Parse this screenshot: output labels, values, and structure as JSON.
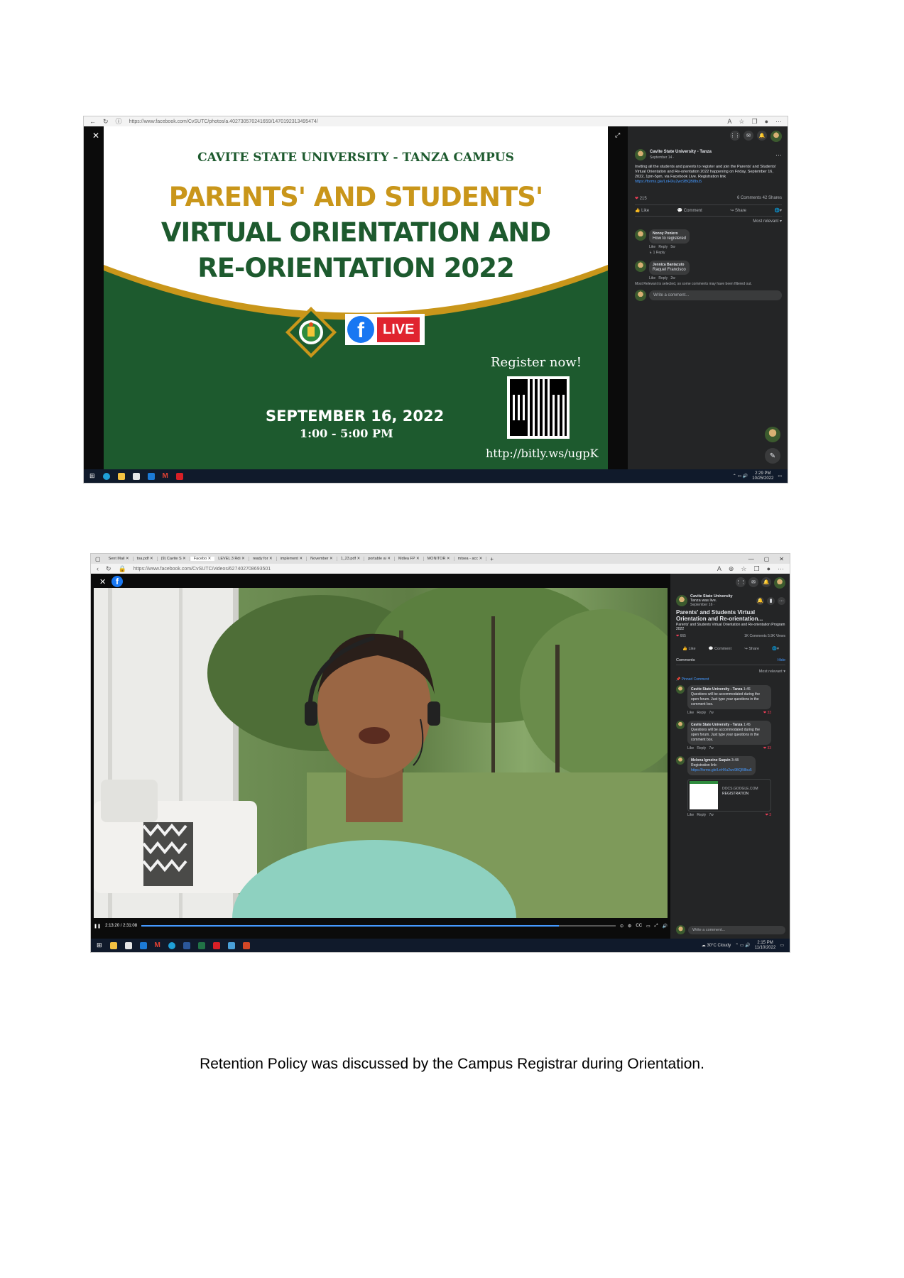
{
  "shot1": {
    "url": "https://www.facebook.com/CvSUTC/photos/a.402730570241659/1470192313495474/",
    "poster": {
      "campus": "CAVITE STATE UNIVERSITY - TANZA CAMPUS",
      "title_line1": "PARENTS' AND STUDENTS'",
      "title_line2": "VIRTUAL ORIENTATION AND",
      "title_line3": "RE-ORIENTATION 2022",
      "live_label": "LIVE",
      "register": "Register now!",
      "date": "SEPTEMBER 16, 2022",
      "time": "1:00 - 5:00 PM",
      "link": "http://bitly.ws/ugpK"
    },
    "post": {
      "page_name": "Cavite State University - Tanza",
      "date": "September 14 · ",
      "body": "Inviting all the students and parents to register and join the Parents' and Students' Virtual Orientation and Re-orientation 2022 happening on Friday, September 16, 2022, 1pm-5pm, via Facebook Live. Registration link",
      "reg_link": "https://forms.gle/LnHXu2wc9BQB8bu5",
      "reactions": "215",
      "counts": "6 Comments  42 Shares",
      "like": "Like",
      "comment": "Comment",
      "share": "Share",
      "sort": "Most relevant",
      "comments": [
        {
          "name": "Nonoy Poniero",
          "text": "How to registered",
          "like": "Like",
          "reply": "Reply",
          "age": "5w",
          "replies": "1 Reply"
        },
        {
          "name": "Jennica Bantacuto",
          "text": "Raquel Francisco",
          "like": "Like",
          "reply": "Reply",
          "age": "2w"
        }
      ],
      "filter_note": "Most Relevant is selected, so some comments may have been filtered out.",
      "write_placeholder": "Write a comment..."
    },
    "tray": {
      "time": "2:29 PM",
      "date": "10/25/2022"
    }
  },
  "shot2": {
    "tabs": [
      "Sent Mail",
      "toa.pdf",
      "(9) Cavite S",
      "Facebo",
      "LEVEL 3 Rdi",
      "ready for",
      "implement",
      "November",
      "1_23.pdf",
      "portable ai",
      "Mdlea FP",
      "MONITOR",
      "mtsea - acc"
    ],
    "url": "https://www.facebook.com/CvSUTC/videos/627402708693501",
    "video_time": "2:13:20 / 2:31:08",
    "post": {
      "page_name": "Cavite State University",
      "subline": "Tanza was live.",
      "date": "September 16 · ",
      "title": "Parents' and Students Virtual Orientation and Re-orientation...",
      "desc": "Parents' and Students Virtual Orientation and Re-orientation Program 2022",
      "reactions": "665",
      "counts": "1K Comments  5.9K Views",
      "like": "Like",
      "comment": "Comment",
      "share": "Share",
      "comments_tab": "Comments",
      "hide": "Hide",
      "sort": "Most relevant",
      "pinned": "Pinned Comment",
      "comments": [
        {
          "name": "Cavite State University - Tanza",
          "stamp": "1:45",
          "text": "Questions will be accommodated during the open forum. Just type your questions in the comment box.",
          "like": "Like",
          "reply": "Reply",
          "age": "7w",
          "hearts": "33"
        },
        {
          "name": "Cavite State University - Tanza",
          "stamp": "1:45",
          "text": "Questions will be accommodated during the open forum. Just type your questions in the comment box.",
          "like": "Like",
          "reply": "Reply",
          "age": "7w",
          "hearts": "33"
        },
        {
          "name": "Melona Igmeine Saquin",
          "stamp": "3:48",
          "text": "Registration link:",
          "link": "https://forms.gle/LnHXu2wc9BQB8bu5",
          "like": "Like",
          "reply": "Reply",
          "age": "7w",
          "hearts": "3"
        }
      ],
      "preview_domain": "DOCS.GOOGLE.COM",
      "preview_title": "REGISTRATION",
      "write_placeholder": "Write a comment..."
    },
    "tray": {
      "weather": "30°C  Cloudy",
      "time": "2:15 PM",
      "date": "11/10/2022"
    }
  },
  "caption": "Retention Policy was discussed by the Campus Registrar during Orientation.",
  "colors": {
    "poster_green": "#1d5a2e",
    "poster_gold": "#c9961a",
    "fb_blue": "#1877f2",
    "fb_dark": "#242526",
    "live_red": "#e0242f"
  }
}
